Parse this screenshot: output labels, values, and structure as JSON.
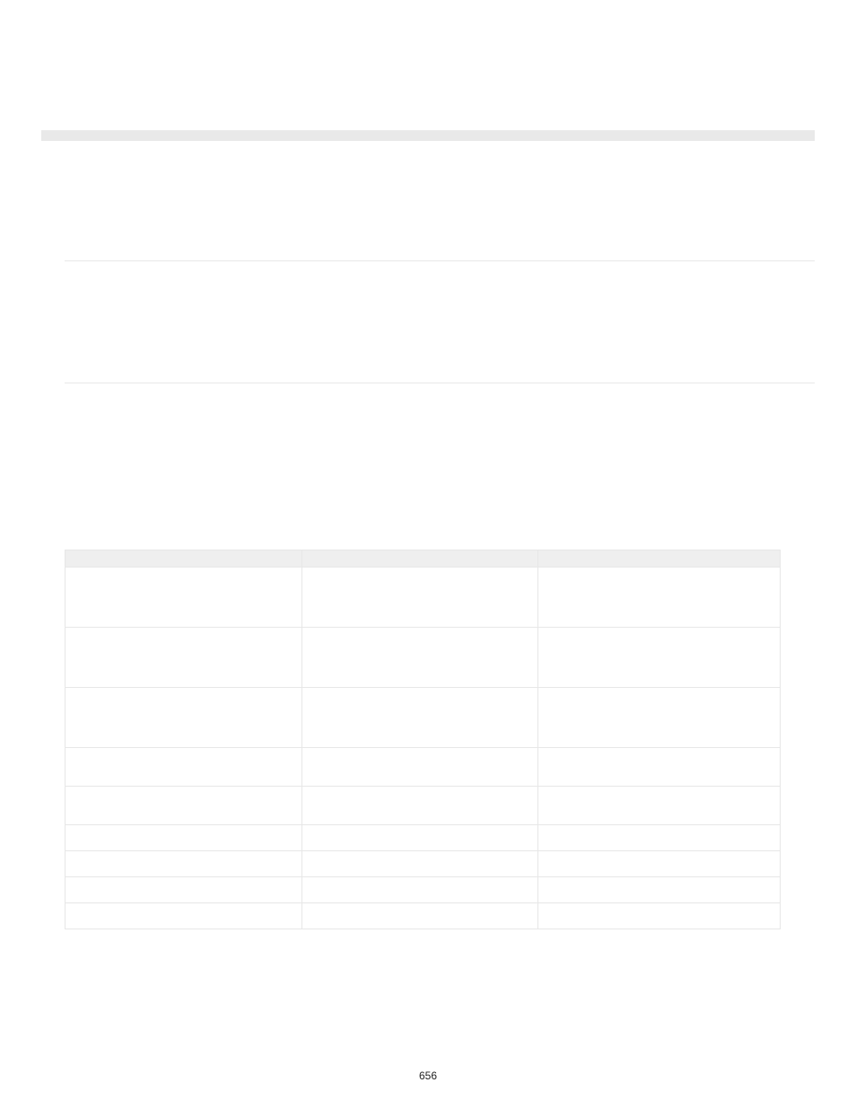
{
  "pageNumber": "656",
  "table": {
    "headers": [
      "",
      "",
      ""
    ],
    "rows": [
      [
        "",
        "",
        ""
      ],
      [
        "",
        "",
        ""
      ],
      [
        "",
        "",
        ""
      ],
      [
        "",
        "",
        ""
      ],
      [
        "",
        "",
        ""
      ],
      [
        "",
        "",
        ""
      ],
      [
        "",
        "",
        ""
      ],
      [
        "",
        "",
        ""
      ],
      [
        "",
        "",
        ""
      ]
    ]
  }
}
